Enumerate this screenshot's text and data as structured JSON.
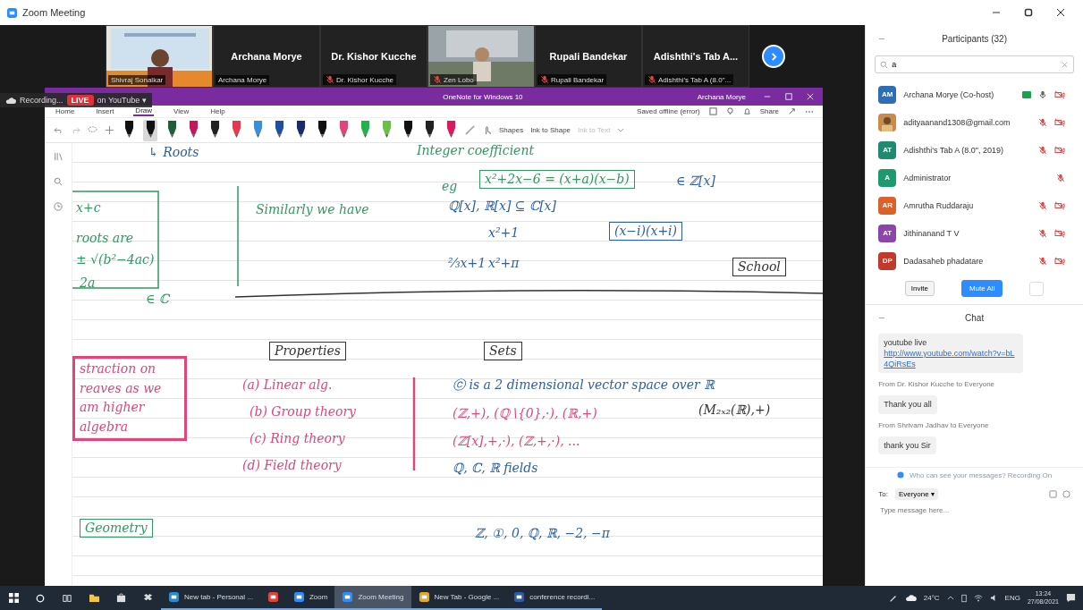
{
  "window": {
    "title": "Zoom Meeting"
  },
  "video_strip": {
    "tiles": [
      {
        "kind": "video",
        "label": "Shivraj Sonalkar",
        "muted": false
      },
      {
        "kind": "name",
        "name": "Archana Morye",
        "label": "Archana Morye",
        "muted": false
      },
      {
        "kind": "name",
        "name": "Dr. Kishor Kucche",
        "label": "Dr. Kishor Kucche",
        "muted": true
      },
      {
        "kind": "video",
        "label": "Zen Lobo",
        "muted": true
      },
      {
        "kind": "name",
        "name": "Rupali Bandekar",
        "label": "Rupali Bandekar",
        "muted": true
      },
      {
        "kind": "name",
        "name": "Adishthi's Tab A...",
        "label": "Adishthi's Tab A (8.0\"...",
        "muted": true
      }
    ]
  },
  "recording": {
    "label": "Recording...",
    "live": "LIVE",
    "stream": "on YouTube ▾"
  },
  "onenote": {
    "title": "OneNote for Windows 10",
    "user": "Archana Morye",
    "menu": [
      {
        "label": "Home",
        "selected": false
      },
      {
        "label": "Insert",
        "selected": false
      },
      {
        "label": "Draw",
        "selected": true
      },
      {
        "label": "View",
        "selected": false
      },
      {
        "label": "Help",
        "selected": false
      }
    ],
    "status": "Saved offline (error)",
    "share": "Share",
    "pens": [
      {
        "color": "#111111",
        "selected": false
      },
      {
        "color": "#111111",
        "selected": true
      },
      {
        "color": "#1e5e3a",
        "selected": false
      },
      {
        "color": "#c2185b",
        "selected": false
      },
      {
        "color": "#222222",
        "selected": false
      },
      {
        "color": "#e53950",
        "selected": false
      },
      {
        "color": "#3b8fd6",
        "selected": false
      },
      {
        "color": "#1f4fa0",
        "selected": false
      },
      {
        "color": "#1a2a6c",
        "selected": false
      },
      {
        "color": "#111111",
        "selected": false
      },
      {
        "color": "#e0457b",
        "selected": false
      },
      {
        "color": "#22b14c",
        "selected": false
      },
      {
        "color": "#6cc04a",
        "selected": false
      },
      {
        "color": "#111111",
        "selected": false
      },
      {
        "color": "#222222",
        "selected": false
      },
      {
        "color": "#d81b60",
        "selected": false
      }
    ],
    "tools": [
      {
        "label": "Shapes",
        "disabled": false
      },
      {
        "label": "Ink to Shape",
        "disabled": false
      },
      {
        "label": "Ink to Text",
        "disabled": true
      }
    ],
    "notes": [
      {
        "text": "↳ Roots",
        "color": "#2b5fa8",
        "boxed": false
      },
      {
        "text": "Integer coefficient",
        "color": "#2e9a5c",
        "boxed": false
      },
      {
        "text": "eg",
        "color": "#2e9a5c",
        "boxed": false
      },
      {
        "text": "x²+2x−6 = (x+a)(x−b)",
        "color": "#2e9a5c",
        "boxed": true
      },
      {
        "text": "∈ ℤ[x]",
        "color": "#2b5fa8",
        "boxed": false
      },
      {
        "text": "x+c",
        "color": "#2e9a5c",
        "boxed": false
      },
      {
        "text": "roots are",
        "color": "#2e9a5c",
        "boxed": false
      },
      {
        "text": "± √(b²−4ac)",
        "color": "#2e9a5c",
        "boxed": false
      },
      {
        "text": "2a",
        "color": "#2e9a5c",
        "boxed": false
      },
      {
        "text": "∈ ℂ",
        "color": "#2e9a5c",
        "boxed": false
      },
      {
        "text": "Similarly we have",
        "color": "#2e9a5c",
        "boxed": false
      },
      {
        "text": "ℚ[x], ℝ[x] ⊆ ℂ[x]",
        "color": "#2b5fa8",
        "boxed": false
      },
      {
        "text": "x²+1",
        "color": "#2b5fa8",
        "boxed": false
      },
      {
        "text": "(x−i)(x+i)",
        "color": "#2b5fa8",
        "boxed": true
      },
      {
        "text": "⅔x+1",
        "color": "#2b5fa8",
        "boxed": false
      },
      {
        "text": "x²+π",
        "color": "#2b5fa8",
        "boxed": false
      },
      {
        "text": "School",
        "color": "#333333",
        "boxed": true
      },
      {
        "text": "straction on reaves as we am higher algebra",
        "color": "#e0457b",
        "boxed": true
      },
      {
        "text": "Properties",
        "color": "#333333",
        "boxed": true
      },
      {
        "text": "Sets",
        "color": "#333333",
        "boxed": true
      },
      {
        "text": "(a) Linear alg.",
        "color": "#e0457b",
        "boxed": false
      },
      {
        "text": "(b) Group theory",
        "color": "#e0457b",
        "boxed": false
      },
      {
        "text": "(c) Ring theory",
        "color": "#e0457b",
        "boxed": false
      },
      {
        "text": "(d) Field theory",
        "color": "#e0457b",
        "boxed": false
      },
      {
        "text": "ⓒ is a 2 dimensional vector space over ℝ",
        "color": "#2b5fa8",
        "boxed": false
      },
      {
        "text": "(ℤ,+), (ℚ∖{0},·), (ℝ,+)",
        "color": "#e0457b",
        "boxed": false
      },
      {
        "text": "(M₂ₓ₂(ℝ),+)",
        "color": "#333333",
        "boxed": false
      },
      {
        "text": "(ℤ[x],+,·), (ℤ,+,·), ...",
        "color": "#e0457b",
        "boxed": false
      },
      {
        "text": "ℚ, ℂ, ℝ fields",
        "color": "#2b5fa8",
        "boxed": false
      },
      {
        "text": "Geometry",
        "color": "#2e9a5c",
        "boxed": true
      },
      {
        "text": "ℤ, ①, 0, ℚ, ℝ, −2, −π",
        "color": "#2b5fa8",
        "boxed": false
      }
    ]
  },
  "participants": {
    "title": "Participants (32)",
    "search": "a",
    "items": [
      {
        "kind": "initials",
        "initials": "AM",
        "color": "#2f6db5",
        "name": "Archana Morye (Co-host)",
        "sharing": true,
        "muted": false,
        "video_off": true
      },
      {
        "name": "adityaanand1308@gmail.com",
        "sharing": false,
        "muted": true,
        "video_off": true
      },
      {
        "kind": "initials",
        "initials": "AT",
        "color": "#1f8a70",
        "name": "Adishthi's Tab A (8.0\", 2019)",
        "sharing": false,
        "muted": true,
        "video_off": true
      },
      {
        "kind": "initials",
        "initials": "A",
        "color": "#1f9a6e",
        "name": "Administrator",
        "sharing": false,
        "muted": true,
        "video_off": false
      },
      {
        "kind": "initials",
        "initials": "AR",
        "color": "#d9622b",
        "name": "Amrutha Ruddaraju",
        "sharing": false,
        "muted": true,
        "video_off": true
      },
      {
        "kind": "initials",
        "initials": "AT",
        "color": "#8e44ad",
        "name": "Jithinanand T V",
        "sharing": false,
        "muted": true,
        "video_off": true
      },
      {
        "kind": "initials",
        "initials": "DP",
        "color": "#c0392b",
        "name": "Dadasaheb phadatare",
        "sharing": false,
        "muted": true,
        "video_off": true
      }
    ],
    "buttons": [
      {
        "label": "Invite",
        "kind": "plain"
      },
      {
        "label": "Mute All",
        "kind": "primary"
      }
    ]
  },
  "chat": {
    "title": "Chat",
    "items": [
      {
        "kind": "bubble",
        "text": "youtube live",
        "link": "http://www.youtube.com/watch?v=bL4QiRsEs"
      },
      {
        "kind": "sender",
        "text": "From Dr. Kishor Kucche to Everyone"
      },
      {
        "kind": "bubble",
        "text": "Thank you all"
      },
      {
        "kind": "sender",
        "text": "From Shrivam Jadhav to Everyone"
      },
      {
        "kind": "bubble",
        "text": "thank you Sir"
      }
    ],
    "notice": "Who can see your messages? Recording On",
    "to_label": "To:",
    "recipient": "Everyone ▾",
    "placeholder": "Type message here..."
  },
  "taskbar": {
    "apps": [
      {
        "label": "New tab - Personal ...",
        "kind": "edge",
        "active": false
      },
      {
        "kind": "office",
        "active": false
      },
      {
        "label": "Zoom",
        "kind": "zoom",
        "active": false
      },
      {
        "label": "Zoom Meeting",
        "kind": "zoom",
        "active": true
      },
      {
        "label": "New Tab - Google ...",
        "kind": "chrome",
        "active": false
      },
      {
        "label": "conference recordi...",
        "kind": "word",
        "active": false
      }
    ],
    "temperature": "24°C",
    "language": "ENG",
    "time": "13:24",
    "date": "27/08/2021"
  }
}
